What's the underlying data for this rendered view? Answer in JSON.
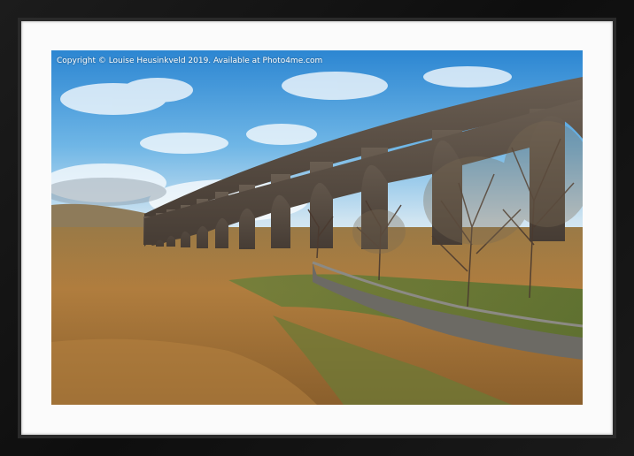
{
  "watermark": {
    "text": "Copyright  © Louise Heusinkveld  2019. Available at Photo4me.com"
  },
  "colors": {
    "frame": "#151515",
    "mount": "#fbfbfb",
    "sky_top": "#2f8fd8",
    "sky_bottom": "#cfe6f3",
    "grass": "#a8783c",
    "stone": "#5a5048",
    "wall": "#6e6c66"
  }
}
